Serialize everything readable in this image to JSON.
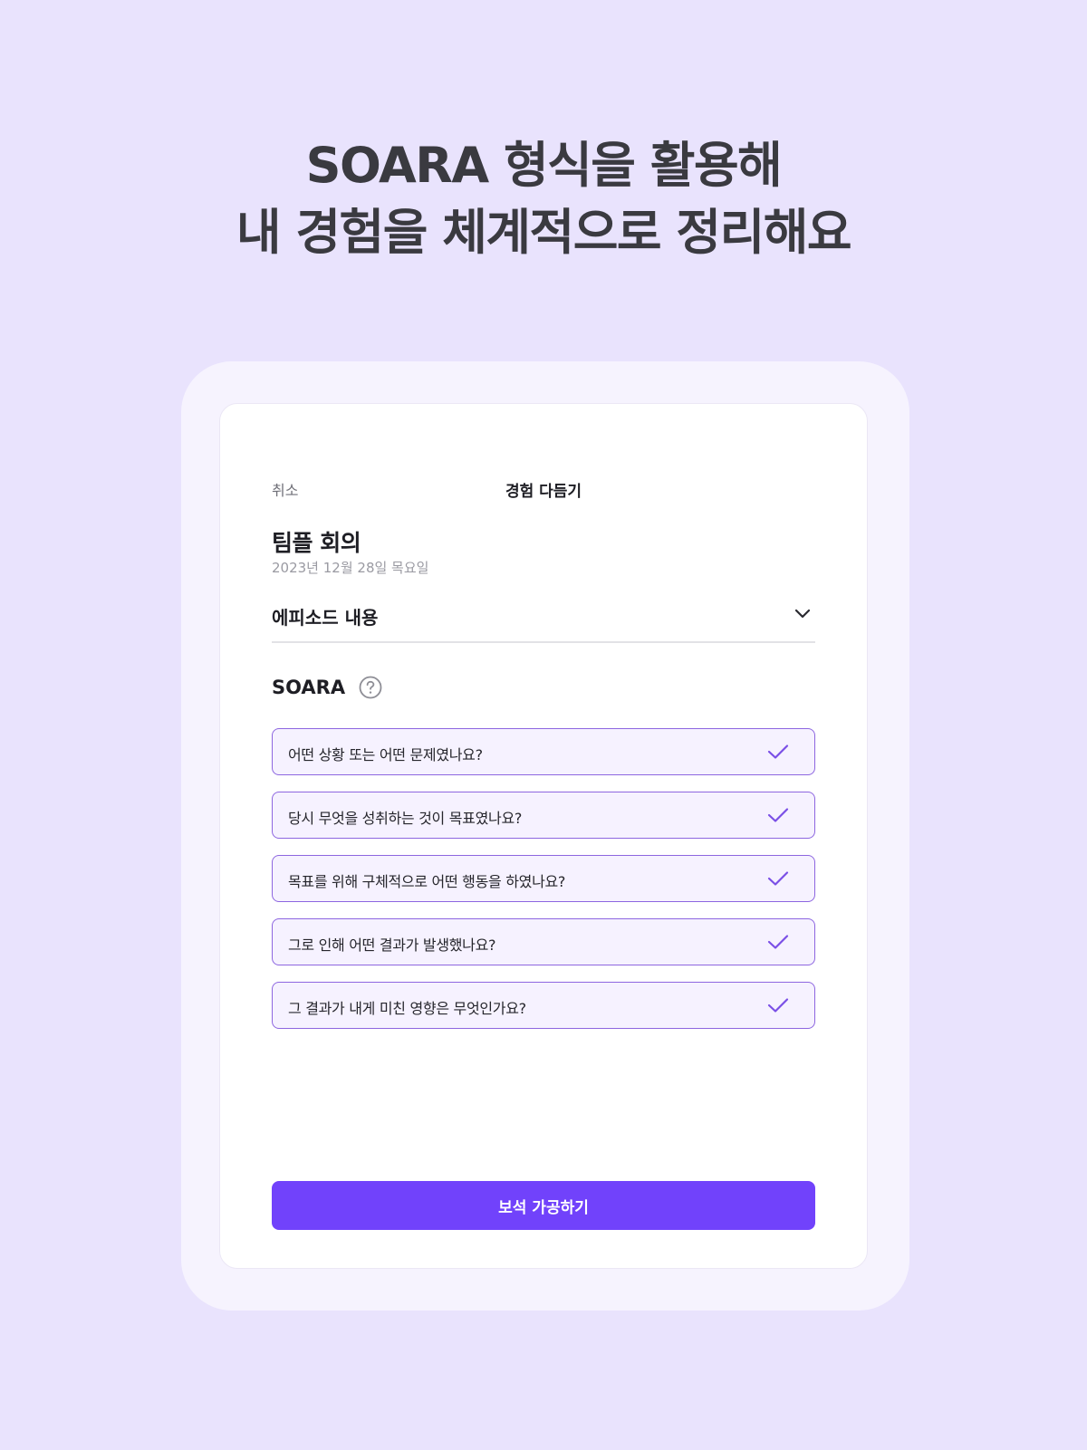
{
  "headline": {
    "line1": "SOARA 형식을 활용해",
    "line2": "내 경험을 체계적으로 정리해요"
  },
  "header": {
    "cancel_label": "취소",
    "title": "경험 다듬기"
  },
  "experience": {
    "title": "팀플 회의",
    "date": "2023년 12월 28일 목요일"
  },
  "episode": {
    "label": "에피소드 내용",
    "icon": "chevron-down-icon"
  },
  "soara": {
    "label": "SOARA",
    "help_icon": "question-circle-icon",
    "questions": [
      {
        "text": "어떤 상황 또는 어떤 문제였나요?",
        "checked": true
      },
      {
        "text": "당시 무엇을 성취하는 것이 목표였나요?",
        "checked": true
      },
      {
        "text": "목표를 위해 구체적으로 어떤 행동을 하였나요?",
        "checked": true
      },
      {
        "text": "그로 인해 어떤 결과가 발생했나요?",
        "checked": true
      },
      {
        "text": "그 결과가 내게 미친 영향은 무엇인가요?",
        "checked": true
      }
    ]
  },
  "cta": {
    "label": "보석 가공하기"
  },
  "colors": {
    "background": "#e9e3fd",
    "accent": "#7142fb",
    "item_border": "#8d66e0",
    "item_fill": "#f6f2ff"
  }
}
